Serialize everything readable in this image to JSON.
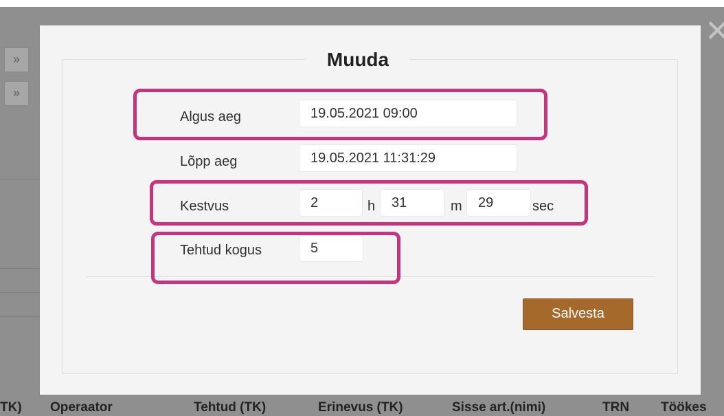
{
  "background": {
    "expand_button_icon": "»",
    "close_icon": "✕",
    "columns": [
      "TK)",
      "Operaator",
      "Tehtud (TK)",
      "Erinevus (TK)",
      "Sisse art.(nimi)",
      "TRN",
      "Töökes"
    ]
  },
  "dialog": {
    "title": "Muuda",
    "fields": {
      "start_label": "Algus aeg",
      "start_value": "19.05.2021 09:00",
      "end_label": "Lõpp aeg",
      "end_value": "19.05.2021 11:31:29",
      "duration_label": "Kestvus",
      "duration_hours": "2",
      "hours_unit": "h",
      "duration_minutes": "31",
      "minutes_unit": "m",
      "duration_seconds": "29",
      "seconds_unit": "sec",
      "quantity_label": "Tehtud kogus",
      "quantity_value": "5"
    },
    "save_label": "Salvesta"
  },
  "colors": {
    "accent": "#a5692c",
    "highlight": "#c7337d",
    "overlay": "#8f8f8f"
  }
}
